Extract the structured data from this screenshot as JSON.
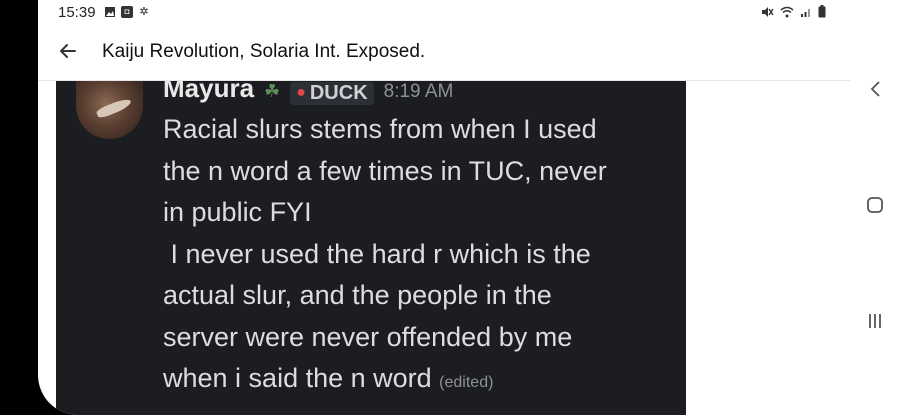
{
  "status_bar": {
    "time": "15:39",
    "left_icons": [
      "image-icon",
      "notification-box-icon",
      "gear-icon"
    ],
    "right_icons": [
      "mute-icon",
      "wifi-icon",
      "signal-icon",
      "battery-icon"
    ]
  },
  "app_bar": {
    "title": "Kaiju Revolution, Solaria Int. Exposed.",
    "back_icon": "arrow-left-icon"
  },
  "message": {
    "username": "Mayura",
    "badge_icon": "leaf-icon",
    "role_icon": "mushroom-icon",
    "role": "DUCK",
    "timestamp": "8:19 AM",
    "lines": [
      "Racial slurs stems from when I used",
      "the n word a few times in TUC, never",
      "in public FYI",
      " I never used the hard r which is the",
      "actual slur, and the people in the",
      "server were never offended by me",
      "when i said the n word"
    ],
    "edited_label": "(edited)"
  },
  "nav_bar": {
    "buttons": [
      "back-nav-icon",
      "home-nav-icon",
      "recents-nav-icon"
    ]
  },
  "colors": {
    "media_background": "#1c1d21",
    "message_text": "#dcdde0",
    "username_text": "#e9e9ea",
    "timestamp_text": "#8e9097",
    "role_icon": "#e0474c",
    "leaf_icon": "#5f8f5a"
  }
}
